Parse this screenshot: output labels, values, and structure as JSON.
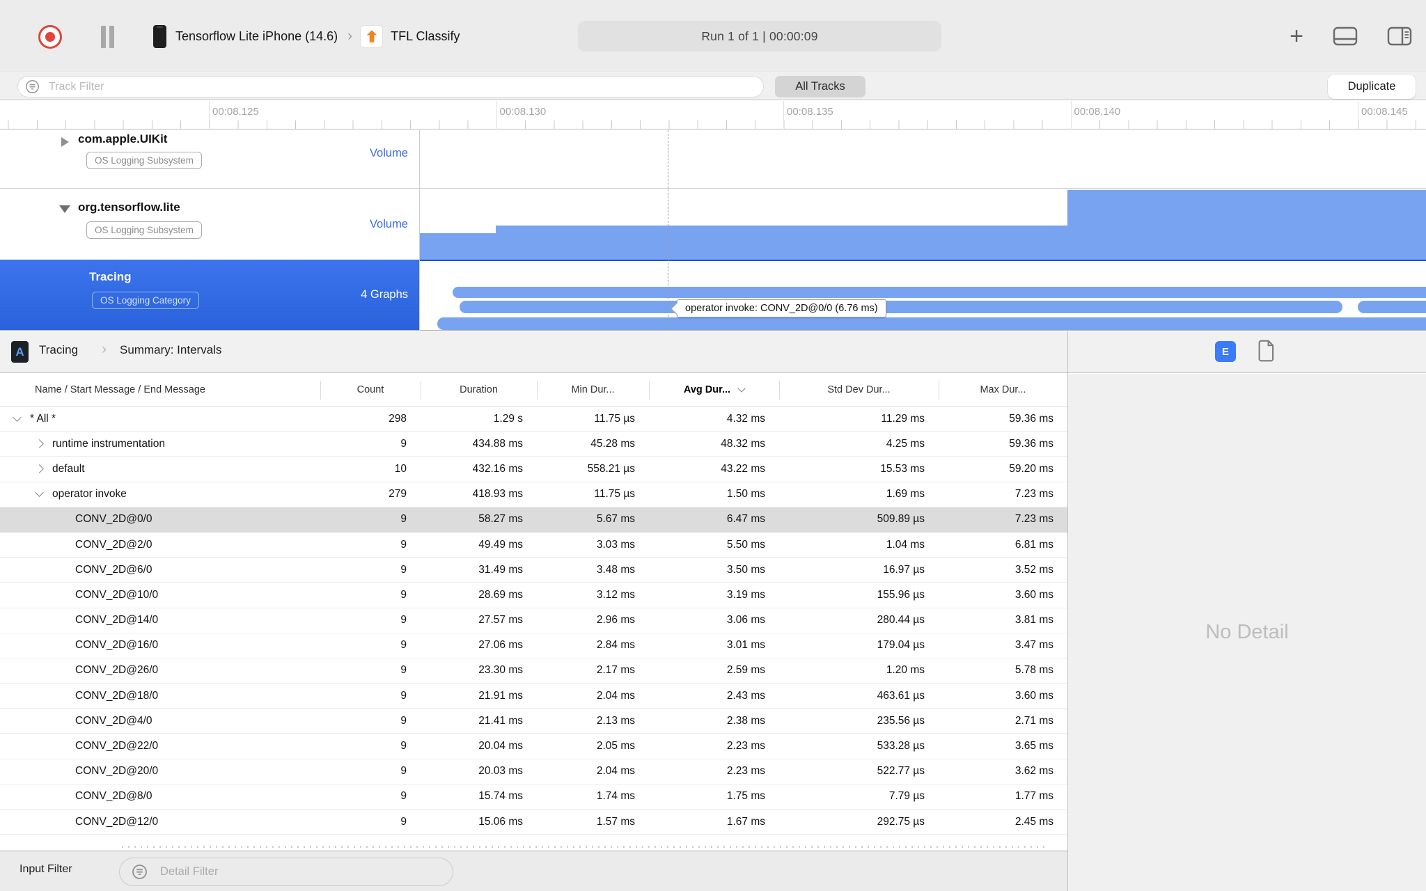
{
  "toolbar": {
    "device": "Tensorflow Lite iPhone (14.6)",
    "target": "TFL Classify",
    "run_info": "Run 1 of 1  |  00:00:09",
    "plus": "+",
    "crumb_separator": "›"
  },
  "filter_bar": {
    "track_filter_placeholder": "Track Filter",
    "all_tracks_label": "All Tracks",
    "duplicate_label": "Duplicate"
  },
  "ruler": {
    "labels": [
      "00:08.125",
      "00:08.130",
      "00:08.135",
      "00:08.140",
      "00:08.145"
    ]
  },
  "tracks": [
    {
      "name": "com.apple.UIKit",
      "badge": "OS Logging Subsystem",
      "meta": "Volume",
      "state": "collapsed"
    },
    {
      "name": "org.tensorflow.lite",
      "badge": "OS Logging Subsystem",
      "meta": "Volume",
      "state": "expanded"
    },
    {
      "name": "Tracing",
      "badge": "OS Logging Category",
      "meta": "4 Graphs",
      "state": "selected"
    }
  ],
  "timeline_tooltip": "operator invoke: CONV_2D@0/0 (6.76 ms)",
  "detail_header": {
    "breadcrumb_icon_letter": "A",
    "breadcrumb_root": "Tracing",
    "breadcrumb_separator": "›",
    "breadcrumb_page": "Summary: Intervals",
    "e_button_label": "E"
  },
  "table": {
    "columns": [
      "Name / Start Message / End Message",
      "Count",
      "Duration",
      "Min Dur...",
      "Avg Dur...",
      "Std Dev Dur...",
      "Max Dur..."
    ],
    "sorted_column": "Avg Dur...",
    "sort_direction": "descending",
    "rows": [
      {
        "level": 0,
        "disclosure": "expanded",
        "name": "* All *",
        "count": "298",
        "duration": "1.29 s",
        "min": "11.75 µs",
        "avg": "4.32 ms",
        "std": "11.29 ms",
        "max": "59.36 ms"
      },
      {
        "level": 1,
        "disclosure": "collapsed",
        "name": "runtime instrumentation",
        "count": "9",
        "duration": "434.88 ms",
        "min": "45.28 ms",
        "avg": "48.32 ms",
        "std": "4.25 ms",
        "max": "59.36 ms"
      },
      {
        "level": 1,
        "disclosure": "collapsed",
        "name": "default",
        "count": "10",
        "duration": "432.16 ms",
        "min": "558.21 µs",
        "avg": "43.22 ms",
        "std": "15.53 ms",
        "max": "59.20 ms"
      },
      {
        "level": 1,
        "disclosure": "expanded",
        "name": "operator invoke",
        "count": "279",
        "duration": "418.93 ms",
        "min": "11.75 µs",
        "avg": "1.50 ms",
        "std": "1.69 ms",
        "max": "7.23 ms"
      },
      {
        "level": 2,
        "selected": true,
        "name": "CONV_2D@0/0",
        "count": "9",
        "duration": "58.27 ms",
        "min": "5.67 ms",
        "avg": "6.47 ms",
        "std": "509.89 µs",
        "max": "7.23 ms"
      },
      {
        "level": 2,
        "name": "CONV_2D@2/0",
        "count": "9",
        "duration": "49.49 ms",
        "min": "3.03 ms",
        "avg": "5.50 ms",
        "std": "1.04 ms",
        "max": "6.81 ms"
      },
      {
        "level": 2,
        "name": "CONV_2D@6/0",
        "count": "9",
        "duration": "31.49 ms",
        "min": "3.48 ms",
        "avg": "3.50 ms",
        "std": "16.97 µs",
        "max": "3.52 ms"
      },
      {
        "level": 2,
        "name": "CONV_2D@10/0",
        "count": "9",
        "duration": "28.69 ms",
        "min": "3.12 ms",
        "avg": "3.19 ms",
        "std": "155.96 µs",
        "max": "3.60 ms"
      },
      {
        "level": 2,
        "name": "CONV_2D@14/0",
        "count": "9",
        "duration": "27.57 ms",
        "min": "2.96 ms",
        "avg": "3.06 ms",
        "std": "280.44 µs",
        "max": "3.81 ms"
      },
      {
        "level": 2,
        "name": "CONV_2D@16/0",
        "count": "9",
        "duration": "27.06 ms",
        "min": "2.84 ms",
        "avg": "3.01 ms",
        "std": "179.04 µs",
        "max": "3.47 ms"
      },
      {
        "level": 2,
        "name": "CONV_2D@26/0",
        "count": "9",
        "duration": "23.30 ms",
        "min": "2.17 ms",
        "avg": "2.59 ms",
        "std": "1.20 ms",
        "max": "5.78 ms"
      },
      {
        "level": 2,
        "name": "CONV_2D@18/0",
        "count": "9",
        "duration": "21.91 ms",
        "min": "2.04 ms",
        "avg": "2.43 ms",
        "std": "463.61 µs",
        "max": "3.60 ms"
      },
      {
        "level": 2,
        "name": "CONV_2D@4/0",
        "count": "9",
        "duration": "21.41 ms",
        "min": "2.13 ms",
        "avg": "2.38 ms",
        "std": "235.56 µs",
        "max": "2.71 ms"
      },
      {
        "level": 2,
        "name": "CONV_2D@22/0",
        "count": "9",
        "duration": "20.04 ms",
        "min": "2.05 ms",
        "avg": "2.23 ms",
        "std": "533.28 µs",
        "max": "3.65 ms"
      },
      {
        "level": 2,
        "name": "CONV_2D@20/0",
        "count": "9",
        "duration": "20.03 ms",
        "min": "2.04 ms",
        "avg": "2.23 ms",
        "std": "522.77 µs",
        "max": "3.62 ms"
      },
      {
        "level": 2,
        "name": "CONV_2D@8/0",
        "count": "9",
        "duration": "15.74 ms",
        "min": "1.74 ms",
        "avg": "1.75 ms",
        "std": "7.79 µs",
        "max": "1.77 ms"
      },
      {
        "level": 2,
        "name": "CONV_2D@12/0",
        "count": "9",
        "duration": "15.06 ms",
        "min": "1.57 ms",
        "avg": "1.67 ms",
        "std": "292.75 µs",
        "max": "2.45 ms"
      }
    ]
  },
  "right_panel": {
    "empty_message": "No Detail"
  },
  "bottom_bar": {
    "input_filter_label": "Input Filter",
    "detail_filter_placeholder": "Detail Filter"
  },
  "colors": {
    "selection_blue": "#2F6AE3",
    "graph_blue": "#78A3F0",
    "record_red": "#DF4538",
    "e_button_blue": "#3B7BF7",
    "volume_label_blue": "#3A6EDE"
  }
}
